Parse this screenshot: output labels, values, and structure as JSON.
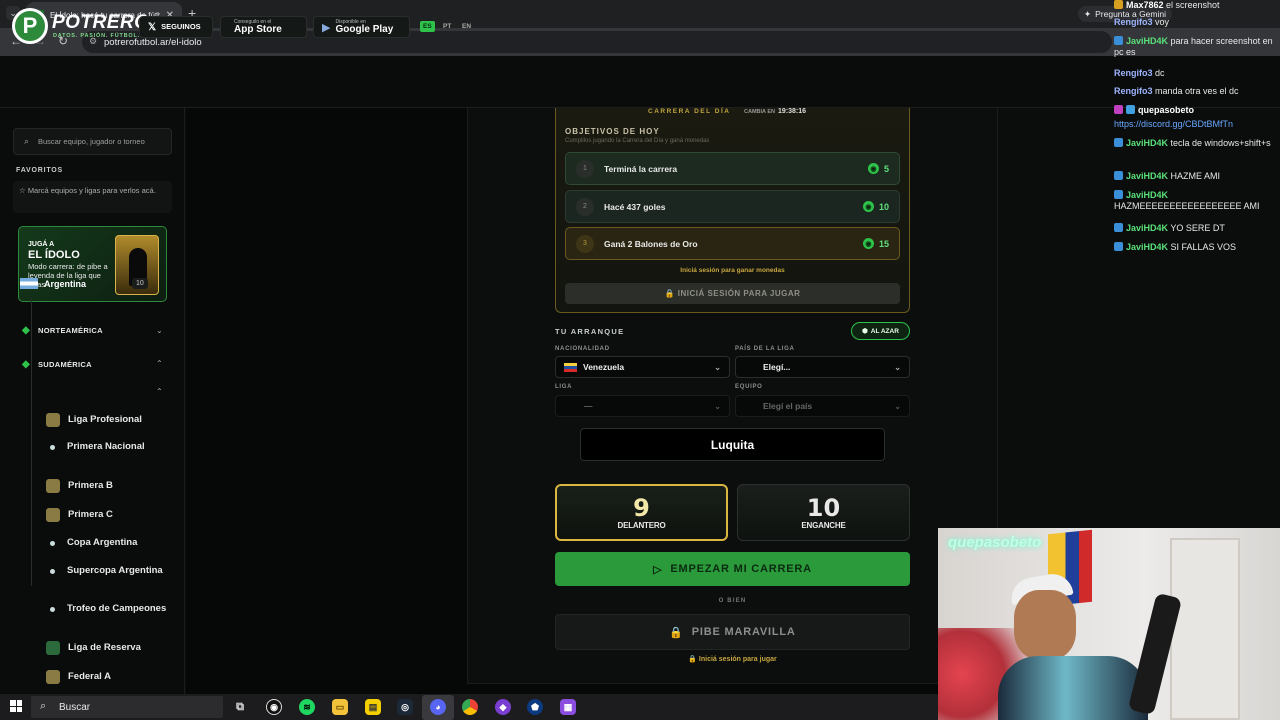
{
  "browser": {
    "tab_title": "El Ídolo: hacé tu carrera de fútb",
    "tab_close": "✕",
    "new_tab": "+",
    "url": "potrerofutbol.ar/el-idolo",
    "gemini_label": "Pregunta a Gemini"
  },
  "header": {
    "brand": "POTRERO",
    "tagline": "DATOS. PASIÓN. FÚTBOL.",
    "follow_label": "SEGUINOS",
    "appstore_small": "Conseguilo en el",
    "appstore_big": "App Store",
    "gplay_small": "Disponible en",
    "gplay_big": "Google Play",
    "langs": [
      "ES",
      "PT",
      "EN"
    ]
  },
  "sidebar": {
    "search_placeholder": "Buscar equipo, jugador o torneo",
    "favorites_title": "FAVORITOS",
    "favorites_hint": "Marcá equipos y ligas para verlos acá.",
    "promo": {
      "line1": "JUGÁ A",
      "line2": "EL ÍDOLO",
      "line3": "Modo carrera: de pibe a leyenda de la liga que elijas"
    },
    "regions": [
      "NORTEAMÉRICA",
      "SUDAMÉRICA"
    ],
    "country": "Argentina",
    "country_count": "10",
    "leagues": [
      "Liga Profesional",
      "Primera Nacional",
      "Primera B",
      "Primera C",
      "Copa Argentina",
      "Supercopa Argentina",
      "Trofeo de Campeones",
      "Liga de Reserva",
      "Federal A"
    ]
  },
  "career": {
    "day_label": "CARRERA DEL DÍA",
    "changes_label": "CAMBIA EN",
    "countdown": "19:38:16",
    "objectives_title": "OBJETIVOS DE HOY",
    "objectives_sub": "Cumplilos jugando la Carrera del Día y ganá monedas",
    "objectives": [
      {
        "num": "1",
        "text": "Terminá la carrera",
        "reward": "5"
      },
      {
        "num": "2",
        "text": "Hacé 437 goles",
        "reward": "10"
      },
      {
        "num": "3",
        "text": "Ganá 2 Balones de Oro",
        "reward": "15"
      }
    ],
    "login_coins": "Iniciá sesión para ganar monedas",
    "login_play": "🔒 INICIÁ SESIÓN PARA JUGAR"
  },
  "start": {
    "section_title": "TU ARRANQUE",
    "random_label": "AL AZAR",
    "nationality_label": "NACIONALIDAD",
    "nationality_value": "Venezuela",
    "league_country_label": "PAÍS DE LA LIGA",
    "league_country_value": "Elegí...",
    "league_label": "LIGA",
    "league_value": "—",
    "team_label": "EQUIPO",
    "team_value": "Elegí el país",
    "player_name": "Luquita",
    "positions": [
      {
        "number": "9",
        "name": "DELANTERO"
      },
      {
        "number": "10",
        "name": "ENGANCHE"
      }
    ],
    "start_button": "EMPEZAR MI CARRERA",
    "or_label": "O BIEN",
    "wonderkid_button": "PIBE MARAVILLA",
    "wonderkid_note": "🔒 Iniciá sesión para jugar"
  },
  "chat": [
    {
      "user": "Max7862",
      "text": " el screenshot",
      "color": "white"
    },
    {
      "user": "Rengifo3",
      "text": " voy",
      "color": "blue"
    },
    {
      "user": "JaviHD4K",
      "text": " para hacer screenshot en pc es",
      "color": "green"
    },
    {
      "user": "Rengifo3",
      "text": " dc",
      "color": "blue"
    },
    {
      "user": "Rengifo3",
      "text": " manda otra ves el dc",
      "color": "blue"
    },
    {
      "user": "quepasobeto",
      "text": "",
      "color": "white"
    },
    {
      "user": "",
      "text": "https://discord.gg/CBDtBMfTn",
      "color": "link"
    },
    {
      "user": "JaviHD4K",
      "text": " tecla de windows+shift+s",
      "color": "green"
    },
    {
      "user": "JaviHD4K",
      "text": " HAZME AMI",
      "color": "green"
    },
    {
      "user": "JaviHD4K",
      "text": " HAZMEEEEEEEEEEEEEEEEE AMI",
      "color": "green"
    },
    {
      "user": "JaviHD4K",
      "text": " YO SERE DT",
      "color": "green"
    },
    {
      "user": "JaviHD4K",
      "text": " SI FALLAS VOS",
      "color": "green"
    }
  ],
  "webcam": {
    "neon_text": "quepasobeto"
  },
  "taskbar": {
    "search_label": "Buscar"
  },
  "colors": {
    "accent_green": "#2a9a3a",
    "gold": "#d9b740"
  }
}
